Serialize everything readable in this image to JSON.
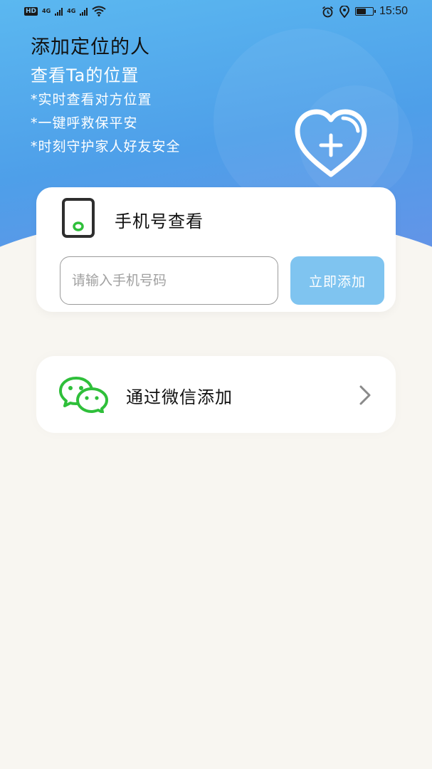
{
  "status_bar": {
    "hd": "HD",
    "net1": "4G",
    "net2": "4G",
    "time": "15:50",
    "battery_level": 0.55,
    "icons": [
      "signal-icon",
      "wifi-icon",
      "alarm-icon",
      "location-icon",
      "battery-icon"
    ]
  },
  "hero": {
    "title": "添加定位的人",
    "subtitle": "查看Ta的位置",
    "features": [
      "*实时查看对方位置",
      "*一键呼救保平安",
      "*时刻守护家人好友安全"
    ],
    "icon": "heart-plus-icon"
  },
  "phone_card": {
    "icon": "phone-icon",
    "title": "手机号查看",
    "input_placeholder": "请输入手机号码",
    "input_value": "",
    "button_label": "立即添加"
  },
  "wechat": {
    "icon": "wechat-icon",
    "label": "通过微信添加",
    "chevron": "chevron-right-icon"
  },
  "colors": {
    "hero_gradient_start": "#5bb8f0",
    "hero_gradient_end": "#6e8ee6",
    "button_bg": "#7fc4f0",
    "wechat_green": "#2fbf3a",
    "background": "#f8f6f1"
  }
}
